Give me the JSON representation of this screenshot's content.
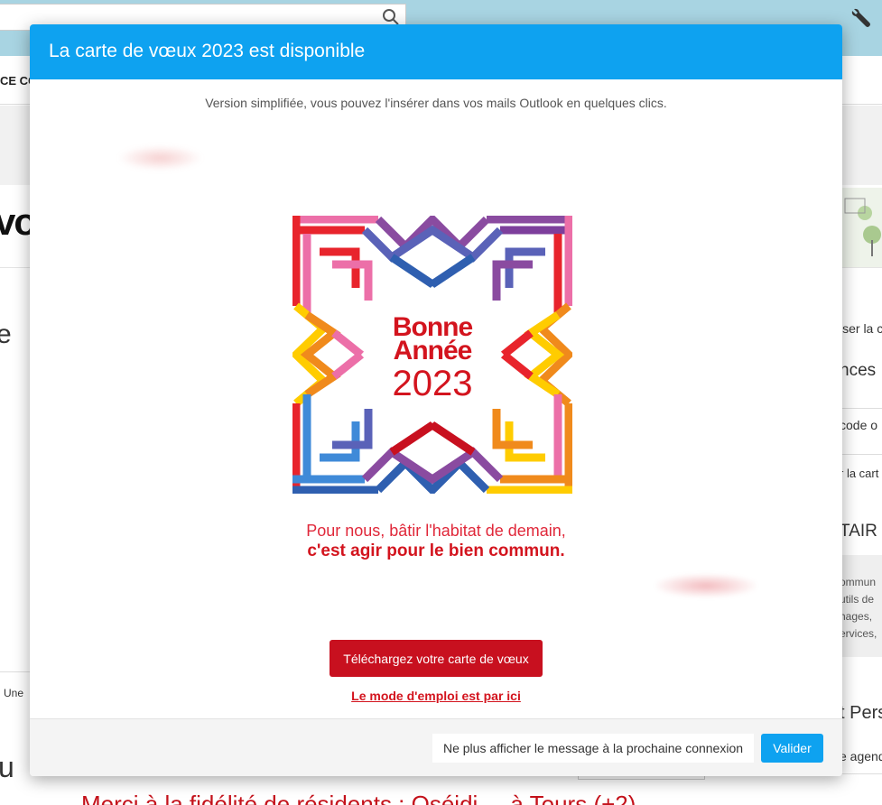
{
  "background": {
    "nav_text": "CE CO",
    "logo_fragment": "vo",
    "letter_e": "e",
    "right_items": [
      "iser la c",
      "nces",
      "code o",
      "r la cart",
      "TAIR",
      "t Pers",
      "e agend"
    ],
    "right_grey_lines": [
      "ommun",
      "utils de",
      "hages, ",
      "ervices,"
    ],
    "une_text": "Une",
    "u_text": "u",
    "red_line": "Merci à la fidélité de résidents : Oséidi ... à Tours (+2)"
  },
  "modal": {
    "title": "La carte de vœux 2023 est disponible",
    "subtitle": "Version simplifiée, vous pouvez l'insérer dans vos mails Outlook en quelques clics.",
    "card": {
      "line1": "Bonne",
      "line2": "Année",
      "year": "2023"
    },
    "slogan_line1": "Pour nous, bâtir l'habitat de demain,",
    "slogan_line2": "c'est agir pour le bien commun.",
    "download_button": "Téléchargez votre carte de vœux",
    "howto_link": "Le mode d'emploi est par ici",
    "dismiss_option": "Ne plus afficher le message à la prochaine connexion",
    "validate_button": "Valider"
  },
  "colors": {
    "header_blue": "#0ea2f0",
    "brand_red": "#c8101f",
    "background_top": "#a8d4e2"
  }
}
